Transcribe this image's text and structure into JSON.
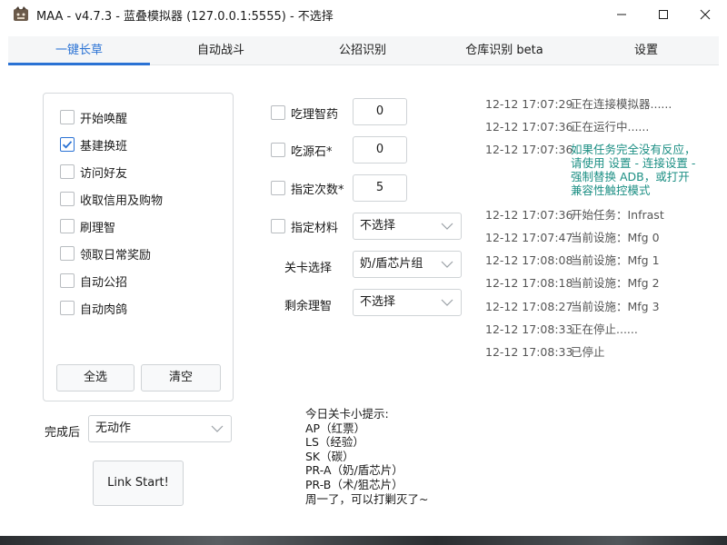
{
  "window": {
    "title": "MAA - v4.7.3 - 蓝叠模拟器 (127.0.0.1:5555) - 不选择"
  },
  "tabs": [
    {
      "label": "一键长草",
      "active": true
    },
    {
      "label": "自动战斗",
      "active": false
    },
    {
      "label": "公招识别",
      "active": false
    },
    {
      "label": "仓库识别 beta",
      "active": false
    },
    {
      "label": "设置",
      "active": false
    }
  ],
  "tasks": {
    "items": [
      {
        "label": "开始唤醒",
        "checked": false
      },
      {
        "label": "基建换班",
        "checked": true
      },
      {
        "label": "访问好友",
        "checked": false
      },
      {
        "label": "收取信用及购物",
        "checked": false
      },
      {
        "label": "刷理智",
        "checked": false
      },
      {
        "label": "领取日常奖励",
        "checked": false
      },
      {
        "label": "自动公招",
        "checked": false
      },
      {
        "label": "自动肉鸽",
        "checked": false
      }
    ],
    "select_all": "全选",
    "clear": "清空"
  },
  "after": {
    "label": "完成后",
    "value": "无动作"
  },
  "start_button": "Link Start!",
  "options": {
    "medicine": {
      "label": "吃理智药",
      "value": "0"
    },
    "stone": {
      "label": "吃源石*",
      "value": "0"
    },
    "times": {
      "label": "指定次数*",
      "value": "5"
    },
    "material": {
      "label": "指定材料",
      "value": "不选择"
    },
    "stage": {
      "label": "关卡选择",
      "value": "奶/盾芯片组"
    },
    "remaining": {
      "label": "剩余理智",
      "value": "不选择"
    }
  },
  "tips": {
    "title": "今日关卡小提示:",
    "lines": [
      "AP（红票）",
      "LS（经验）",
      "SK（碳）",
      "PR-A（奶/盾芯片）",
      "PR-B（术/狙芯片）",
      "周一了，可以打剿灭了~"
    ]
  },
  "log": [
    {
      "time": "12-12  17:07:29",
      "msg": "正在连接模拟器......",
      "type": "info"
    },
    {
      "time": "12-12  17:07:36",
      "msg": "正在运行中......",
      "type": "info"
    },
    {
      "time": "12-12  17:07:36",
      "msg": "如果任务完全没有反应，\n请使用 设置 - 连接设置 -\n强制替换 ADB，或打开\n兼容性触控模式",
      "type": "warn"
    },
    {
      "time": "12-12  17:07:36",
      "msg": "开始任务：Infrast",
      "type": "info"
    },
    {
      "time": "12-12  17:07:47",
      "msg": "当前设施：Mfg 0",
      "type": "info"
    },
    {
      "time": "12-12  17:08:08",
      "msg": "当前设施：Mfg 1",
      "type": "info"
    },
    {
      "time": "12-12  17:08:18",
      "msg": "当前设施：Mfg 2",
      "type": "info"
    },
    {
      "time": "12-12  17:08:27",
      "msg": "当前设施：Mfg 3",
      "type": "info"
    },
    {
      "time": "12-12  17:08:33",
      "msg": "正在停止......",
      "type": "info"
    },
    {
      "time": "12-12  17:08:33",
      "msg": "已停止",
      "type": "info"
    }
  ],
  "colors": {
    "accent": "#2a72d4",
    "warn_text": "#1c8f84"
  }
}
